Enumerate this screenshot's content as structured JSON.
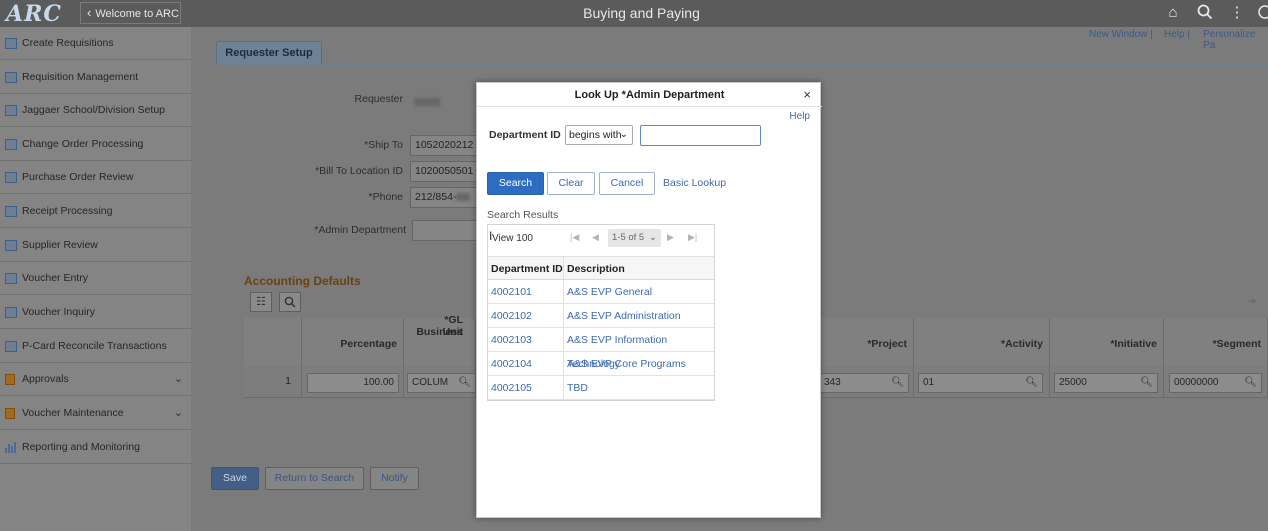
{
  "header": {
    "logo": "ARC",
    "back_label": "Welcome to ARC",
    "title": "Buying and Paying",
    "icons": [
      "home-icon",
      "search-icon",
      "more-vertical-icon",
      "unknown-icon"
    ]
  },
  "sidebar": {
    "items": [
      {
        "label": "Create Requisitions",
        "icon": "page-icon"
      },
      {
        "label": "Requisition Management",
        "icon": "page-icon"
      },
      {
        "label": "Jaggaer School/Division Setup",
        "icon": "page-icon"
      },
      {
        "label": "Change Order Processing",
        "icon": "page-icon"
      },
      {
        "label": "Purchase Order Review",
        "icon": "page-icon"
      },
      {
        "label": "Receipt Processing",
        "icon": "page-icon"
      },
      {
        "label": "Supplier Review",
        "icon": "page-icon"
      },
      {
        "label": "Voucher Entry",
        "icon": "page-icon"
      },
      {
        "label": "Voucher Inquiry",
        "icon": "page-icon"
      },
      {
        "label": "P-Card Reconcile Transactions",
        "icon": "page-icon"
      },
      {
        "label": "Approvals",
        "icon": "folder-icon"
      },
      {
        "label": "Voucher Maintenance",
        "icon": "folder-icon"
      },
      {
        "label": "Reporting and Monitoring",
        "icon": "chart-icon"
      }
    ],
    "collapse_label": "||"
  },
  "top_links": {
    "new_window": "New Window",
    "help": "Help",
    "personalize": "Personalize Pa"
  },
  "form": {
    "tab": "Requester Setup",
    "requester_label": "Requester",
    "ship_to_label": "*Ship To",
    "ship_to_value": "1052020212",
    "bill_to_label": "*Bill To Location ID",
    "bill_to_value": "1020050501",
    "phone_label": "*Phone",
    "phone_value": "212/854-",
    "admin_dept_label": "*Admin Department"
  },
  "accounting": {
    "title": "Accounting Defaults",
    "columns": {
      "percentage": "Percentage",
      "gl_business_unit_1": "*GL Business",
      "gl_business_unit_2": "Unit",
      "project": "*Project",
      "activity": "*Activity",
      "initiative": "*Initiative",
      "segment": "*Segment"
    },
    "row": {
      "index": "1",
      "percentage": "100.00",
      "gl_business_unit": "COLUM",
      "project": "343",
      "activity": "01",
      "initiative": "25000",
      "segment": "00000000"
    }
  },
  "bottom_buttons": {
    "save": "Save",
    "return_to_search": "Return to Search",
    "notify": "Notify"
  },
  "modal": {
    "title": "Look Up *Admin Department",
    "close": "×",
    "help": "Help",
    "field_label": "Department ID",
    "operator": "begins with",
    "input_value": "",
    "search": "Search",
    "clear": "Clear",
    "cancel": "Cancel",
    "basic_lookup": "Basic Lookup",
    "results_title": "Search Results",
    "view_label": "View 100",
    "pager": "1-5 of 5",
    "columns": [
      "Department ID",
      "Description"
    ],
    "rows": [
      {
        "id": "4002101",
        "desc": "A&S EVP General"
      },
      {
        "id": "4002102",
        "desc": "A&S EVP Administration"
      },
      {
        "id": "4002103",
        "desc": "A&S EVP Information Technology"
      },
      {
        "id": "4002104",
        "desc": "A&S EVP Core Programs"
      },
      {
        "id": "4002105",
        "desc": "TBD"
      }
    ]
  },
  "colors": {
    "primary_button": "#2d6cc0",
    "link": "#3c6ab0",
    "section_title": "#6a4212",
    "topbar": "#5b5b5b"
  }
}
